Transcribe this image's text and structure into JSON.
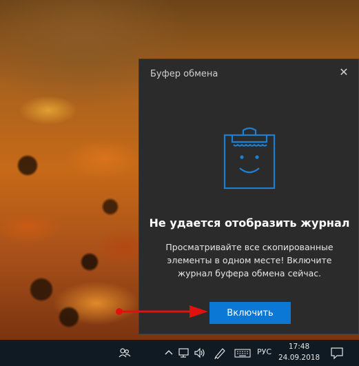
{
  "clipboard_panel": {
    "title": "Буфер обмена",
    "close_glyph": "✕",
    "icon": "clipboard-smile-icon",
    "heading": "Не удается отобразить журнал",
    "description": "Просматривайте все скопированные элементы в одном месте! Включите журнал буфера обмена сейчас.",
    "enable_button_label": "Включить"
  },
  "annotation": {
    "arrow_color": "#e31010"
  },
  "colors": {
    "accent": "#0a78d4",
    "panel_bg": "#2b2b2b",
    "taskbar_bg": "#0f1a22"
  },
  "taskbar": {
    "tray_icons": [
      "people-icon",
      "chevron-up-icon",
      "network-icon",
      "speaker-icon",
      "pen-icon",
      "keyboard-icon"
    ],
    "language": "РУС",
    "time": "17:48",
    "date": "24.09.2018",
    "notification_icon": "action-center-icon"
  }
}
